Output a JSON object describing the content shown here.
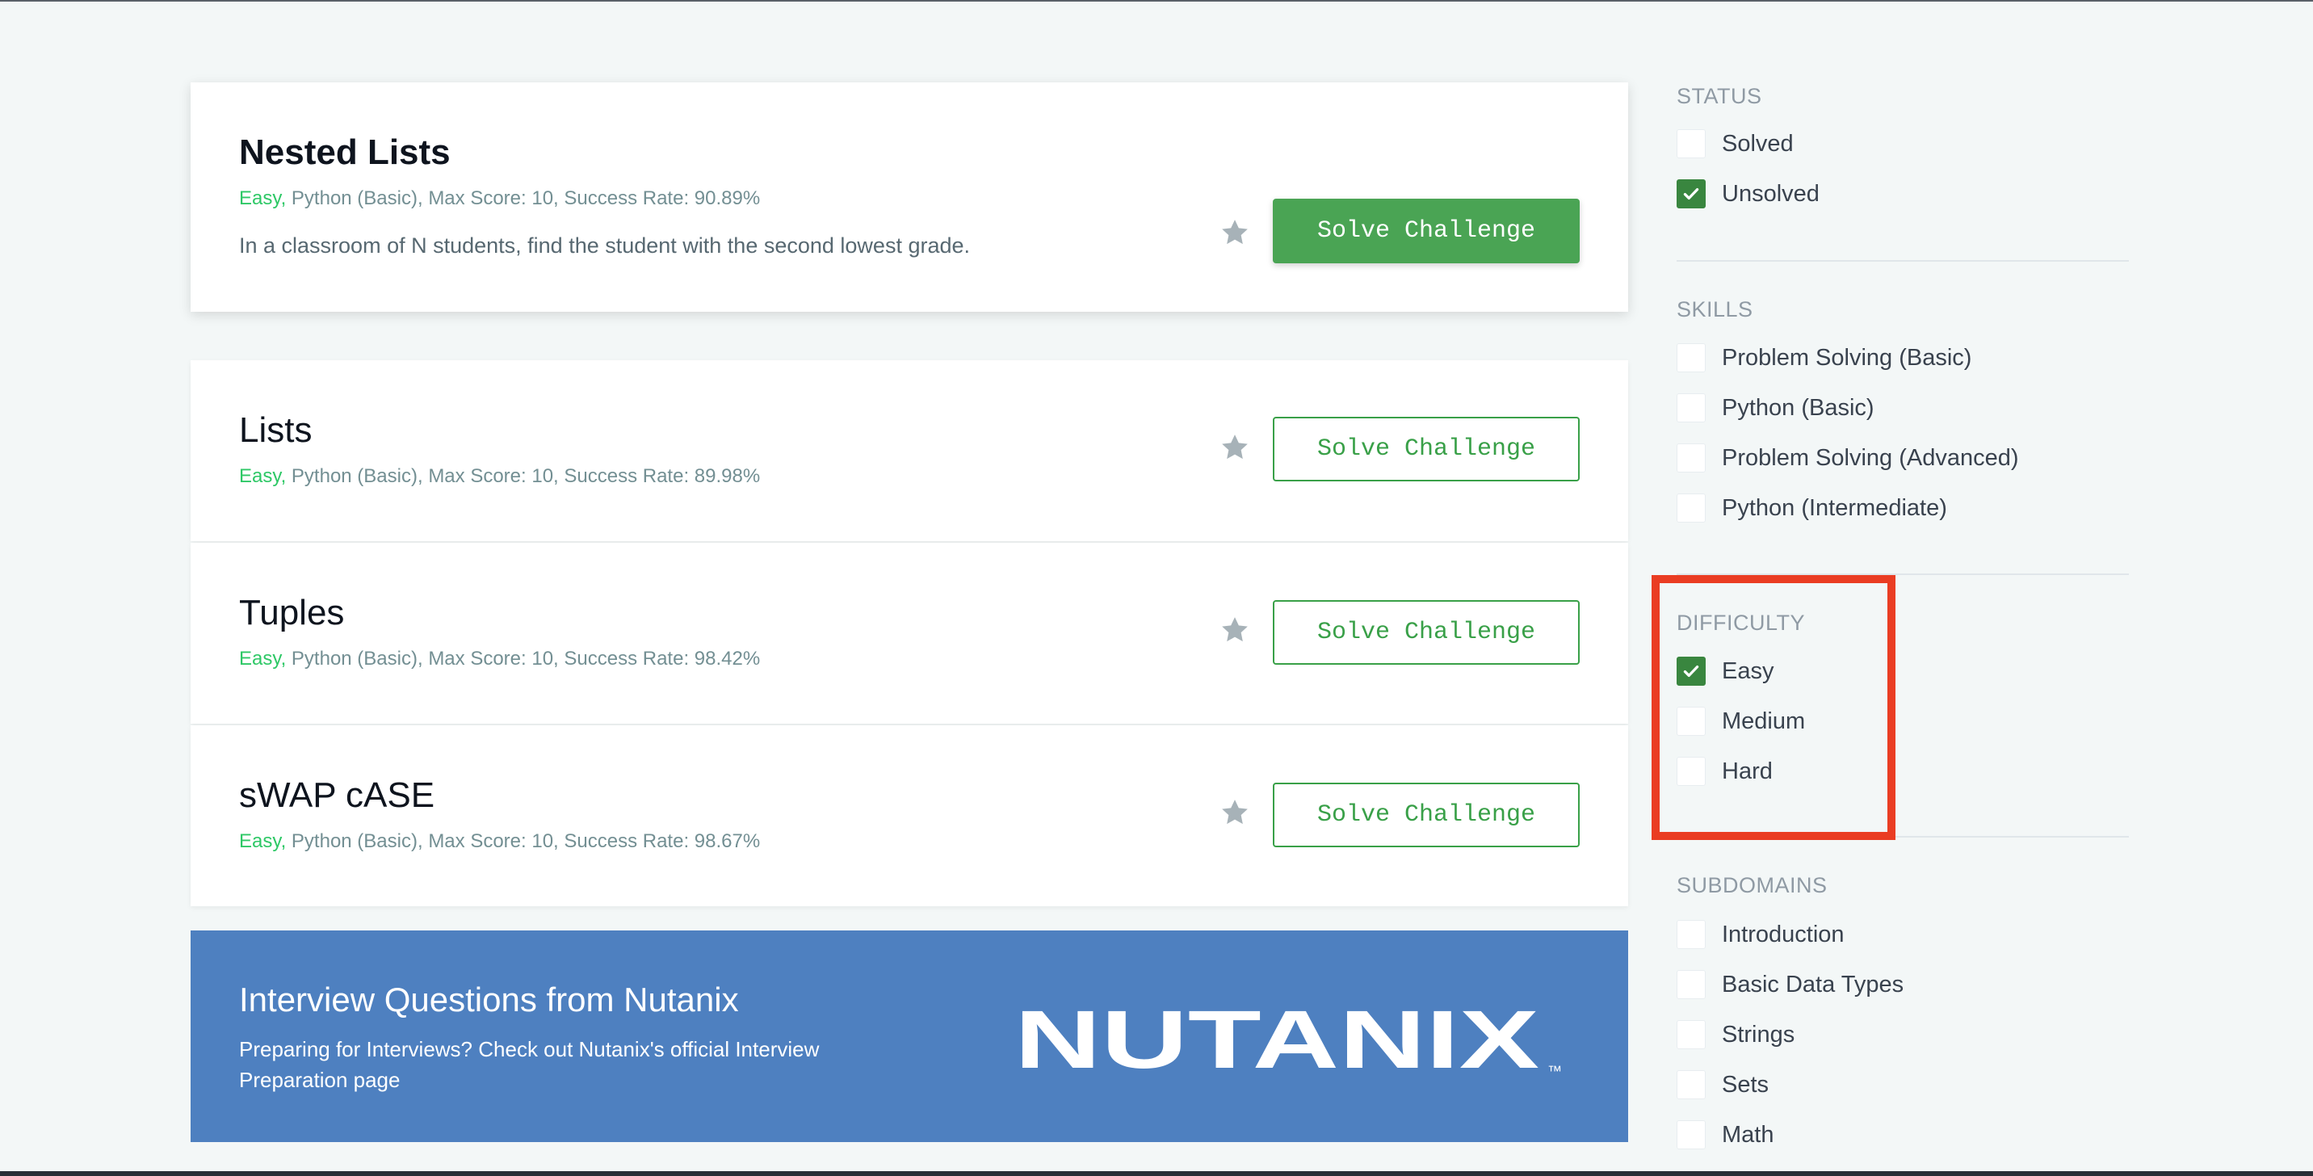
{
  "challenges": [
    {
      "title": "Nested Lists",
      "difficulty": "Easy,",
      "meta": " Python (Basic), Max Score: 10, Success Rate: 90.89%",
      "description": "In a classroom of N students, find the student with the second lowest grade.",
      "button_label": "Solve Challenge",
      "icon": "star-icon"
    },
    {
      "title": "Lists",
      "difficulty": "Easy,",
      "meta": " Python (Basic), Max Score: 10, Success Rate: 89.98%",
      "button_label": "Solve Challenge",
      "icon": "star-icon"
    },
    {
      "title": "Tuples",
      "difficulty": "Easy,",
      "meta": " Python (Basic), Max Score: 10, Success Rate: 98.42%",
      "button_label": "Solve Challenge",
      "icon": "star-icon"
    },
    {
      "title": "sWAP cASE",
      "difficulty": "Easy,",
      "meta": " Python (Basic), Max Score: 10, Success Rate: 98.67%",
      "button_label": "Solve Challenge",
      "icon": "star-icon"
    }
  ],
  "banner": {
    "title": "Interview Questions from Nutanix",
    "text": "Preparing for Interviews? Check out Nutanix's official Interview Preparation page",
    "logo_text": "NUTANIX",
    "logo_mark": "™",
    "color": "#4e80c0"
  },
  "filters": {
    "status": {
      "heading": "STATUS",
      "options": [
        {
          "label": "Solved",
          "checked": false
        },
        {
          "label": "Unsolved",
          "checked": true
        }
      ]
    },
    "skills": {
      "heading": "SKILLS",
      "options": [
        {
          "label": "Problem Solving (Basic)",
          "checked": false
        },
        {
          "label": "Python (Basic)",
          "checked": false
        },
        {
          "label": "Problem Solving (Advanced)",
          "checked": false
        },
        {
          "label": "Python (Intermediate)",
          "checked": false
        }
      ]
    },
    "difficulty": {
      "heading": "DIFFICULTY",
      "options": [
        {
          "label": "Easy",
          "checked": true
        },
        {
          "label": "Medium",
          "checked": false
        },
        {
          "label": "Hard",
          "checked": false
        }
      ]
    },
    "subdomains": {
      "heading": "SUBDOMAINS",
      "options": [
        {
          "label": "Introduction",
          "checked": false
        },
        {
          "label": "Basic Data Types",
          "checked": false
        },
        {
          "label": "Strings",
          "checked": false
        },
        {
          "label": "Sets",
          "checked": false
        },
        {
          "label": "Math",
          "checked": false
        }
      ]
    }
  },
  "colors": {
    "accent_green": "#39a048",
    "checkbox_checked": "#39863f",
    "easy_label": "#2ec866",
    "highlight": "#ea3d23"
  }
}
